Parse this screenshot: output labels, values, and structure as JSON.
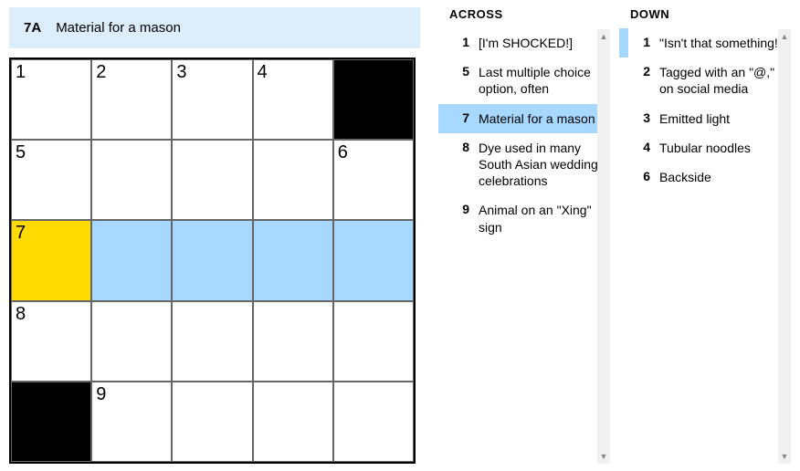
{
  "current_clue": {
    "label": "7A",
    "text": "Material for a mason"
  },
  "grid": {
    "size": 5,
    "cells": [
      [
        {
          "n": "1"
        },
        {
          "n": "2"
        },
        {
          "n": "3"
        },
        {
          "n": "4"
        },
        {
          "black": true
        }
      ],
      [
        {
          "n": "5"
        },
        {},
        {},
        {},
        {
          "n": "6"
        }
      ],
      [
        {
          "n": "7",
          "state": "cursor"
        },
        {
          "state": "hl"
        },
        {
          "state": "hl"
        },
        {
          "state": "hl"
        },
        {
          "state": "hl"
        }
      ],
      [
        {
          "n": "8"
        },
        {},
        {},
        {},
        {}
      ],
      [
        {
          "black": true
        },
        {
          "n": "9"
        },
        {},
        {},
        {}
      ]
    ]
  },
  "across": {
    "title": "ACROSS",
    "items": [
      {
        "num": "1",
        "text": "[I'm SHOCKED!]"
      },
      {
        "num": "5",
        "text": "Last multiple choice option, often"
      },
      {
        "num": "7",
        "text": "Material for a mason",
        "active": true
      },
      {
        "num": "8",
        "text": "Dye used in many South Asian wedding celebrations"
      },
      {
        "num": "9",
        "text": "Animal on an \"Xing\" sign"
      }
    ]
  },
  "down": {
    "title": "DOWN",
    "items": [
      {
        "num": "1",
        "text": "\"Isn't that something!\"",
        "related": true
      },
      {
        "num": "2",
        "text": "Tagged with an \"@,\" on social media"
      },
      {
        "num": "3",
        "text": "Emitted light"
      },
      {
        "num": "4",
        "text": "Tubular noodles"
      },
      {
        "num": "6",
        "text": "Backside"
      }
    ]
  }
}
